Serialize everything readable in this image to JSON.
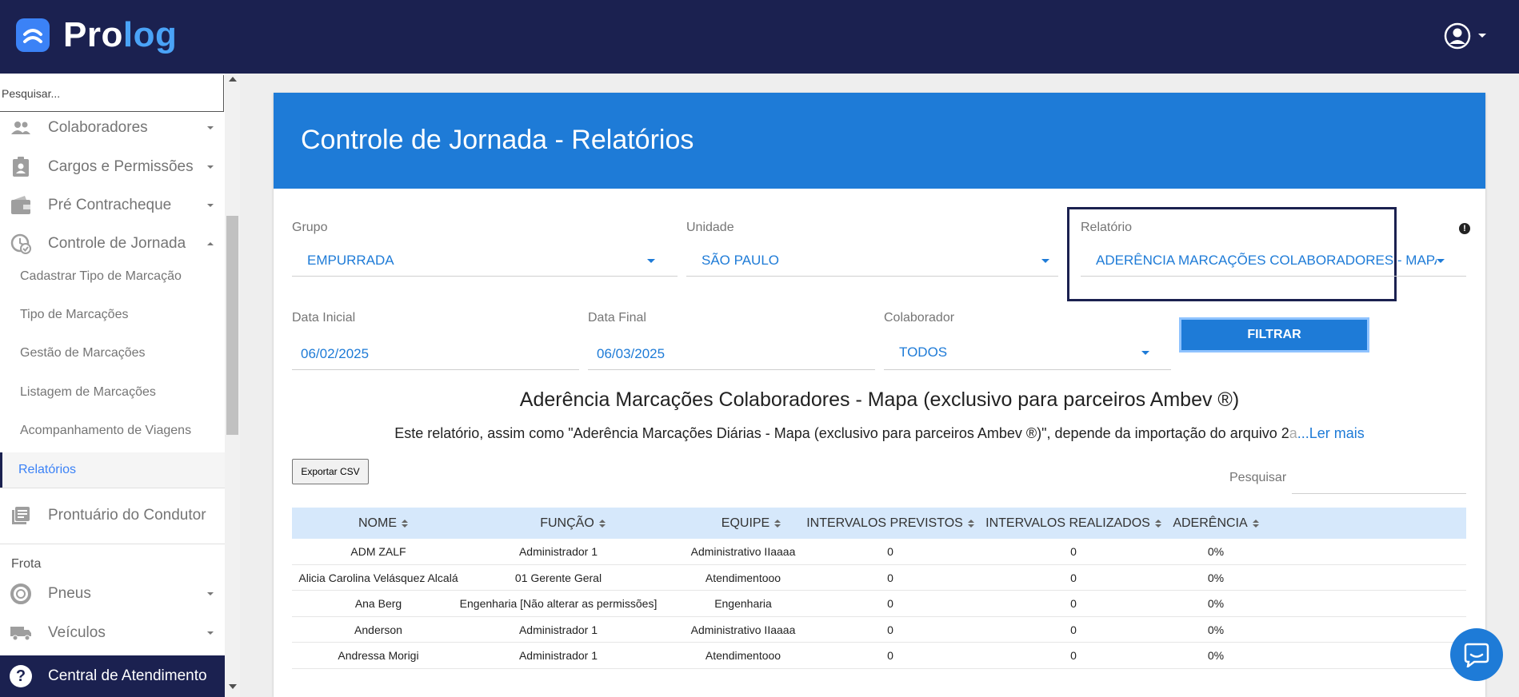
{
  "app": {
    "logo_text_main": "Pro",
    "logo_text_accent": "log"
  },
  "sidebar": {
    "search_placeholder": "Pesquisar...",
    "items": [
      {
        "label": "Colaboradores",
        "icon": "people-icon"
      },
      {
        "label": "Cargos e Permissões",
        "icon": "badge-icon"
      },
      {
        "label": "Pré Contracheque",
        "icon": "wallet-icon"
      },
      {
        "label": "Controle de Jornada",
        "icon": "clock-check-icon"
      }
    ],
    "sub_items": [
      {
        "label": "Cadastrar Tipo de Marcação"
      },
      {
        "label": "Tipo de Marcações"
      },
      {
        "label": "Gestão de Marcações"
      },
      {
        "label": "Listagem de Marcações"
      },
      {
        "label": "Acompanhamento de Viagens"
      },
      {
        "label": "Relatórios",
        "active": true
      }
    ],
    "prontuario": "Prontuário do Condutor",
    "section_frota": "Frota",
    "frota_items": [
      {
        "label": "Pneus",
        "icon": "tire-icon"
      },
      {
        "label": "Veículos",
        "icon": "truck-icon"
      }
    ],
    "help_label": "Central de Atendimento"
  },
  "page": {
    "title": "Controle de Jornada - Relatórios"
  },
  "filters": {
    "grupo_label": "Grupo",
    "grupo_value": "EMPURRADA",
    "unidade_label": "Unidade",
    "unidade_value": "SÃO PAULO",
    "relatorio_label": "Relatório",
    "relatorio_value": "ADERÊNCIA MARCAÇÕES COLABORADORES - MAPA (",
    "data_inicial_label": "Data Inicial",
    "data_inicial_value": "06/02/2025",
    "data_final_label": "Data Final",
    "data_final_value": "06/03/2025",
    "colaborador_label": "Colaborador",
    "colaborador_value": "TODOS",
    "filtrar_label": "FILTRAR"
  },
  "report": {
    "title": "Aderência Marcações Colaboradores - Mapa (exclusivo para parceiros Ambev ®)",
    "description": "Este relatório, assim como \"Aderência Marcações Diárias - Mapa (exclusivo para parceiros Ambev ®)\", depende da importação do arquivo 2",
    "description_fade": "a",
    "read_more": "...Ler mais",
    "export_label": "Exportar CSV",
    "search_label": "Pesquisar"
  },
  "table": {
    "columns": [
      "NOME",
      "FUNÇÃO",
      "EQUIPE",
      "INTERVALOS PREVISTOS",
      "INTERVALOS REALIZADOS",
      "ADERÊNCIA"
    ],
    "rows": [
      [
        "ADM ZALF",
        "Administrador 1",
        "Administrativo IIaaaa",
        "0",
        "0",
        "0%"
      ],
      [
        "Alicia Carolina Velásquez Alcalá",
        "01 Gerente Geral",
        "Atendimentooo",
        "0",
        "0",
        "0%"
      ],
      [
        "Ana Berg",
        "Engenharia [Não alterar as permissões]",
        "Engenharia",
        "0",
        "0",
        "0%"
      ],
      [
        "Anderson",
        "Administrador 1",
        "Administrativo IIaaaa",
        "0",
        "0",
        "0%"
      ],
      [
        "Andressa Morigi",
        "Administrador 1",
        "Atendimentooo",
        "0",
        "0",
        "0%"
      ]
    ]
  }
}
